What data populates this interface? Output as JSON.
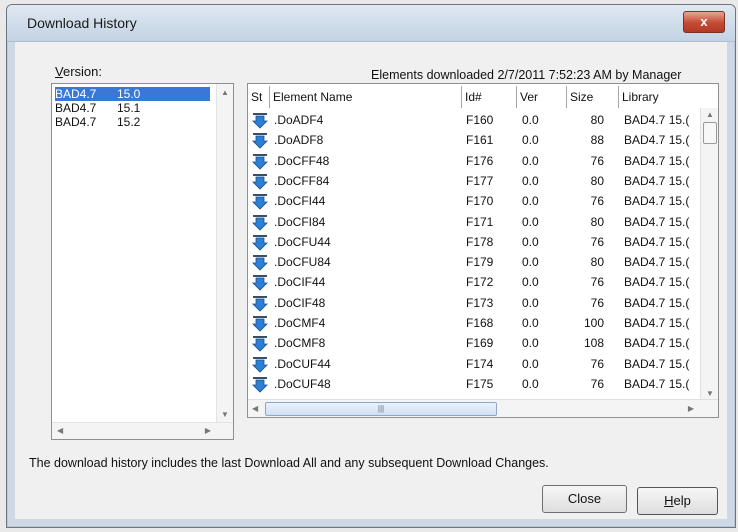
{
  "window": {
    "title": "Download History",
    "close_glyph": "x"
  },
  "version": {
    "label_prefix": "V",
    "label_rest": "ersion:",
    "items": [
      {
        "name": "BAD4.7",
        "ver": "15.0",
        "selected": true
      },
      {
        "name": "BAD4.7",
        "ver": "15.1",
        "selected": false
      },
      {
        "name": "BAD4.7",
        "ver": "15.2",
        "selected": false
      }
    ]
  },
  "status_line": "Elements downloaded 2/7/2011 7:52:23 AM by Manager",
  "grid": {
    "columns": [
      "St",
      "Element Name",
      "Id#",
      "Ver",
      "Size",
      "Library"
    ],
    "hscroll_grip": "|||",
    "rows": [
      {
        "name": ".DoADF4",
        "id": "F160",
        "ver": "0.0",
        "size": "80",
        "library": "BAD4.7 15.("
      },
      {
        "name": ".DoADF8",
        "id": "F161",
        "ver": "0.0",
        "size": "88",
        "library": "BAD4.7 15.("
      },
      {
        "name": ".DoCFF48",
        "id": "F176",
        "ver": "0.0",
        "size": "76",
        "library": "BAD4.7 15.("
      },
      {
        "name": ".DoCFF84",
        "id": "F177",
        "ver": "0.0",
        "size": "80",
        "library": "BAD4.7 15.("
      },
      {
        "name": ".DoCFI44",
        "id": "F170",
        "ver": "0.0",
        "size": "76",
        "library": "BAD4.7 15.("
      },
      {
        "name": ".DoCFI84",
        "id": "F171",
        "ver": "0.0",
        "size": "80",
        "library": "BAD4.7 15.("
      },
      {
        "name": ".DoCFU44",
        "id": "F178",
        "ver": "0.0",
        "size": "76",
        "library": "BAD4.7 15.("
      },
      {
        "name": ".DoCFU84",
        "id": "F179",
        "ver": "0.0",
        "size": "80",
        "library": "BAD4.7 15.("
      },
      {
        "name": ".DoCIF44",
        "id": "F172",
        "ver": "0.0",
        "size": "76",
        "library": "BAD4.7 15.("
      },
      {
        "name": ".DoCIF48",
        "id": "F173",
        "ver": "0.0",
        "size": "76",
        "library": "BAD4.7 15.("
      },
      {
        "name": ".DoCMF4",
        "id": "F168",
        "ver": "0.0",
        "size": "100",
        "library": "BAD4.7 15.("
      },
      {
        "name": ".DoCMF8",
        "id": "F169",
        "ver": "0.0",
        "size": "108",
        "library": "BAD4.7 15.("
      },
      {
        "name": ".DoCUF44",
        "id": "F174",
        "ver": "0.0",
        "size": "76",
        "library": "BAD4.7 15.("
      },
      {
        "name": ".DoCUF48",
        "id": "F175",
        "ver": "0.0",
        "size": "76",
        "library": "BAD4.7 15.("
      }
    ]
  },
  "footer_text": "The download history includes the last Download All  and any subsequent Download Changes.",
  "buttons": {
    "close": "Close",
    "help_prefix": "H",
    "help_rest": "elp"
  },
  "colors": {
    "selection": "#3a78d8",
    "download_icon": "#2a7fd6"
  }
}
